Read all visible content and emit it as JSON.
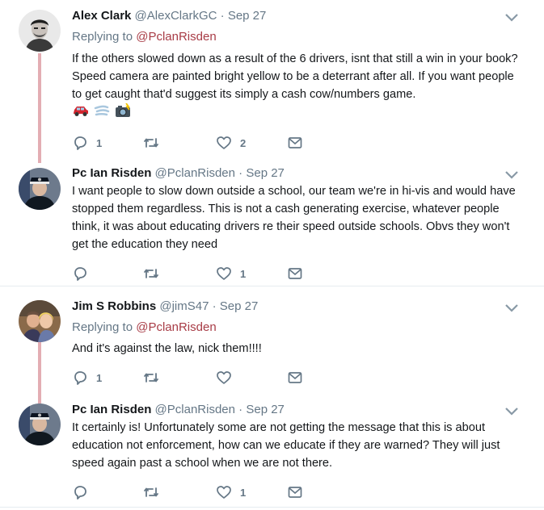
{
  "tweets": [
    {
      "name": "Alex Clark",
      "handle": "@AlexClarkGC",
      "separator": "·",
      "time": "Sep 27",
      "replying_prefix": "Replying to",
      "replying_to": "@PclanRisden",
      "text": "If the others slowed down as a result of the 6 drivers, isnt that still a win in your book? Speed camera are painted bright yellow to be a deterrant after all. If you want people to get caught that'd suggest its simply a cash cow/numbers game.",
      "emojis": [
        "car-emoji",
        "dash-emoji",
        "camera-flash-emoji"
      ],
      "replies": "1",
      "retweets": "",
      "likes": "2"
    },
    {
      "name": "Pc Ian Risden",
      "handle": "@PclanRisden",
      "separator": "·",
      "time": "Sep 27",
      "text": "I want people to slow down outside a school, our team we're in hi-vis and would have stopped them regardless. This is not a cash generating exercise, whatever people think, it was about educating drivers re their speed outside schools. Obvs they won't get the education they need",
      "replies": "",
      "retweets": "",
      "likes": "1"
    },
    {
      "name": "Jim S Robbins",
      "handle": "@jimS47",
      "separator": "·",
      "time": "Sep 27",
      "replying_prefix": "Replying to",
      "replying_to": "@PclanRisden",
      "text": "And it's against the law, nick them!!!!",
      "replies": "1",
      "retweets": "",
      "likes": ""
    },
    {
      "name": "Pc Ian Risden",
      "handle": "@PclanRisden",
      "separator": "·",
      "time": "Sep 27",
      "text": "It certainly is! Unfortunately some are not getting the message that this is about education not enforcement, how can we educate if they are warned? They will just speed again past a school when we are not there.",
      "replies": "",
      "retweets": "",
      "likes": "1"
    }
  ],
  "colors": {
    "thread_line": "#e3adb3",
    "mention": "#a83c46",
    "muted": "#657786",
    "divider": "#e6ecf0"
  }
}
